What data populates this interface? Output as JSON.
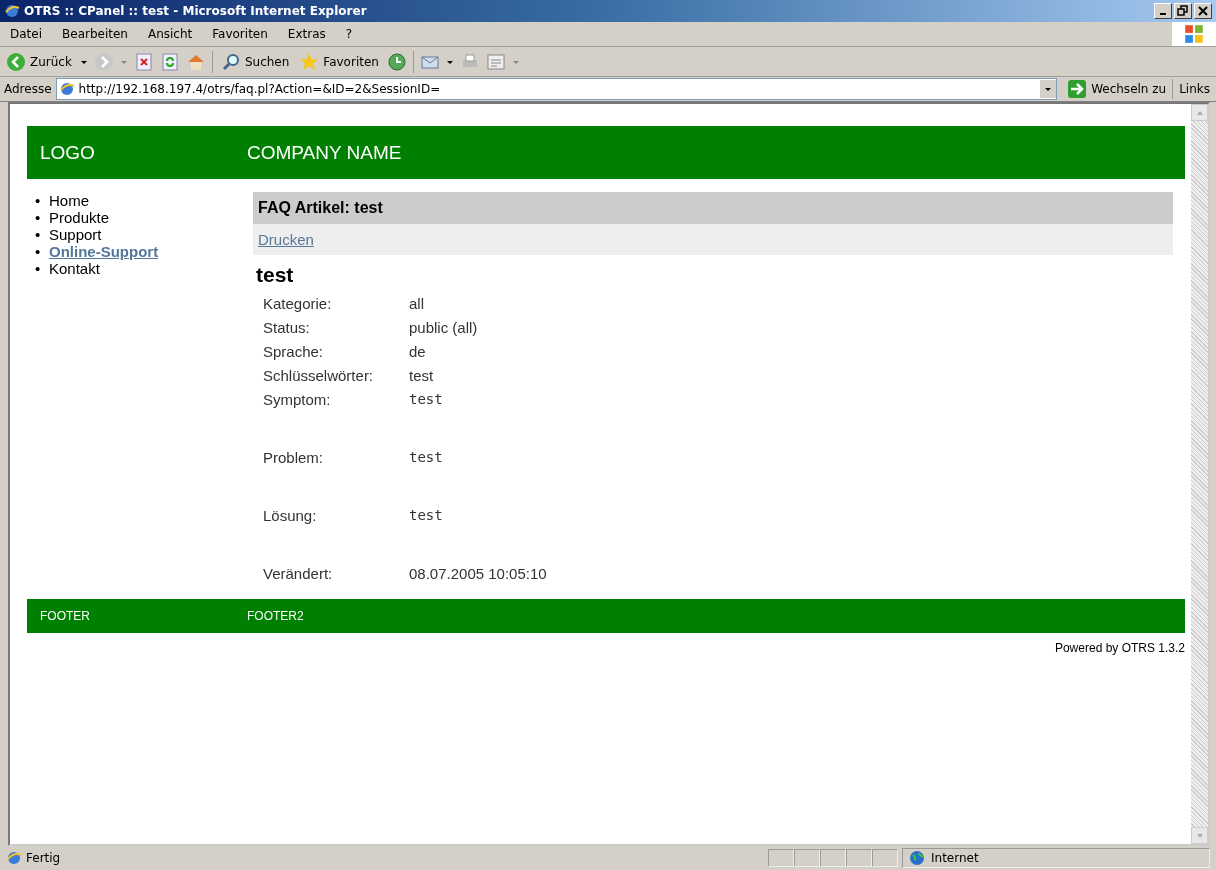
{
  "window": {
    "title": "OTRS :: CPanel :: test - Microsoft Internet Explorer"
  },
  "menu": [
    "Datei",
    "Bearbeiten",
    "Ansicht",
    "Favoriten",
    "Extras",
    "?"
  ],
  "toolbar": {
    "back": "Zurück",
    "search": "Suchen",
    "favorites": "Favoriten"
  },
  "address": {
    "label": "Adresse",
    "value": "http://192.168.197.4/otrs/faq.pl?Action=&ID=2&SessionID=",
    "go": "Wechseln zu",
    "links": "Links"
  },
  "page": {
    "header": {
      "logo": "LOGO",
      "company": "COMPANY NAME"
    },
    "nav": [
      {
        "marker": "•",
        "label": "Home",
        "selected": false
      },
      {
        "marker": "•",
        "label": "Produkte",
        "selected": false
      },
      {
        "marker": "•",
        "label": "Support",
        "selected": false
      },
      {
        "marker": "•",
        "label": "Online-Support",
        "selected": true
      },
      {
        "marker": "•",
        "label": "Kontakt",
        "selected": false
      }
    ],
    "article": {
      "heading": "FAQ Artikel: test",
      "print_link": "Drucken",
      "title": "test",
      "fields": [
        {
          "label": "Kategorie:",
          "value": "all",
          "kind": "plain"
        },
        {
          "label": "Status:",
          "value": "public (all)",
          "kind": "plain"
        },
        {
          "label": "Sprache:",
          "value": "de",
          "kind": "plain"
        },
        {
          "label": "Schlüsselwörter:",
          "value": "test",
          "kind": "plain"
        },
        {
          "label": "Symptom:",
          "value": "test",
          "kind": "block"
        },
        {
          "label": "Problem:",
          "value": "test",
          "kind": "block"
        },
        {
          "label": "Lösung:",
          "value": "test",
          "kind": "block"
        },
        {
          "label": "Verändert:",
          "value": "08.07.2005 10:05:10",
          "kind": "plain"
        }
      ]
    },
    "footer": [
      "FOOTER",
      "FOOTER2"
    ],
    "powered": "Powered by OTRS 1.3.2"
  },
  "status_bar": {
    "text": "Fertig",
    "zone": "Internet"
  }
}
